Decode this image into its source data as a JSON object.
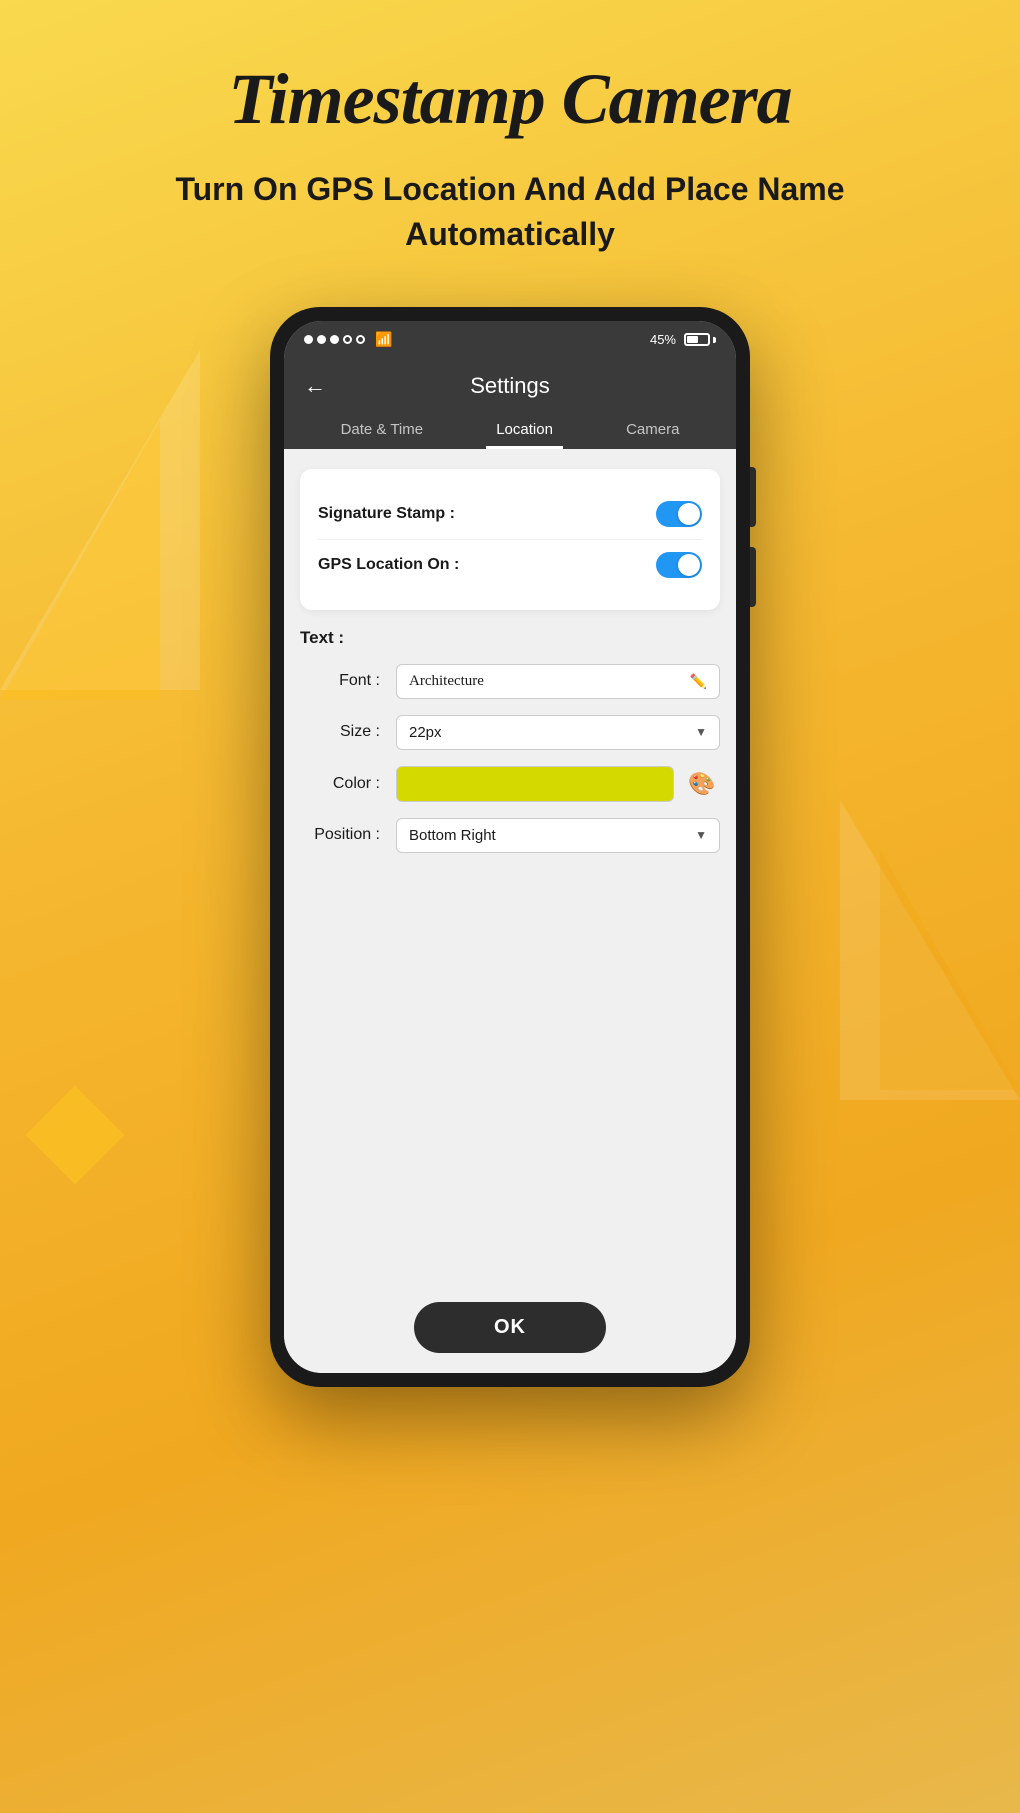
{
  "page": {
    "title": "Timestamp Camera",
    "subtitle": "Turn On GPS Location And Add Place Name Automatically"
  },
  "status_bar": {
    "battery_percent": "45%",
    "wifi": true
  },
  "header": {
    "back_label": "←",
    "title": "Settings"
  },
  "tabs": [
    {
      "label": "Date & Time",
      "active": false
    },
    {
      "label": "Location",
      "active": true
    },
    {
      "label": "Camera",
      "active": false
    }
  ],
  "toggles": [
    {
      "label": "Signature Stamp :",
      "on": true
    },
    {
      "label": "GPS Location On :",
      "on": true
    }
  ],
  "text_section": {
    "label": "Text :",
    "font_label": "Font :",
    "font_value": "Architecture",
    "size_label": "Size :",
    "size_value": "22px",
    "color_label": "Color :",
    "color_value": "#d4d900",
    "position_label": "Position :",
    "position_value": "Bottom Right"
  },
  "ok_button": "OK"
}
